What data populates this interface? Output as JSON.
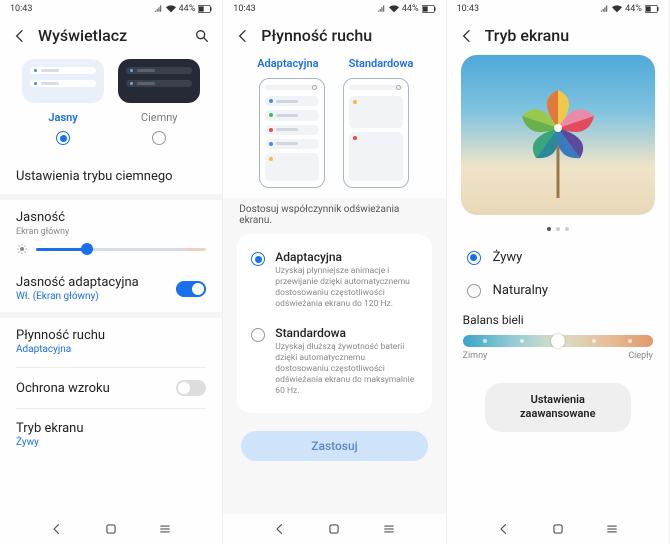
{
  "status": {
    "time": "10:43",
    "battery": "44%"
  },
  "phone1": {
    "title": "Wyświetlacz",
    "theme_light": "Jasny",
    "theme_dark": "Ciemny",
    "dark_settings": "Ustawienia trybu ciemnego",
    "brightness": "Jasność",
    "brightness_sub": "Ekran główny",
    "adaptive_brightness": "Jasność adaptacyjna",
    "adaptive_brightness_sub": "Wł. (Ekran główny)",
    "motion": "Płynność ruchu",
    "motion_sub": "Adaptacyjna",
    "eye": "Ochrona wzroku",
    "mode": "Tryb ekranu",
    "mode_sub": "Żywy"
  },
  "phone2": {
    "title": "Płynność ruchu",
    "tab_adaptive": "Adaptacyjna",
    "tab_standard": "Standardowa",
    "desc": "Dostosuj współczynnik odświeżania ekranu.",
    "opt_adaptive": "Adaptacyjna",
    "opt_adaptive_desc": "Uzyskaj płynniejsze animacje i przewijanie dzięki automatycznemu dostosowaniu częstotliwości odświeżania ekranu do 120 Hz.",
    "opt_standard": "Standardowa",
    "opt_standard_desc": "Uzyskaj dłuższą żywotność baterii dzięki automatycznemu dostosowaniu częstotliwości odświeżania ekranu do maksymalnie 60 Hz.",
    "apply": "Zastosuj"
  },
  "phone3": {
    "title": "Tryb ekranu",
    "vivid": "Żywy",
    "natural": "Naturalny",
    "wb": "Balans bieli",
    "cold": "Zimny",
    "warm": "Ciepły",
    "advanced": "Ustawienia zaawansowane"
  }
}
